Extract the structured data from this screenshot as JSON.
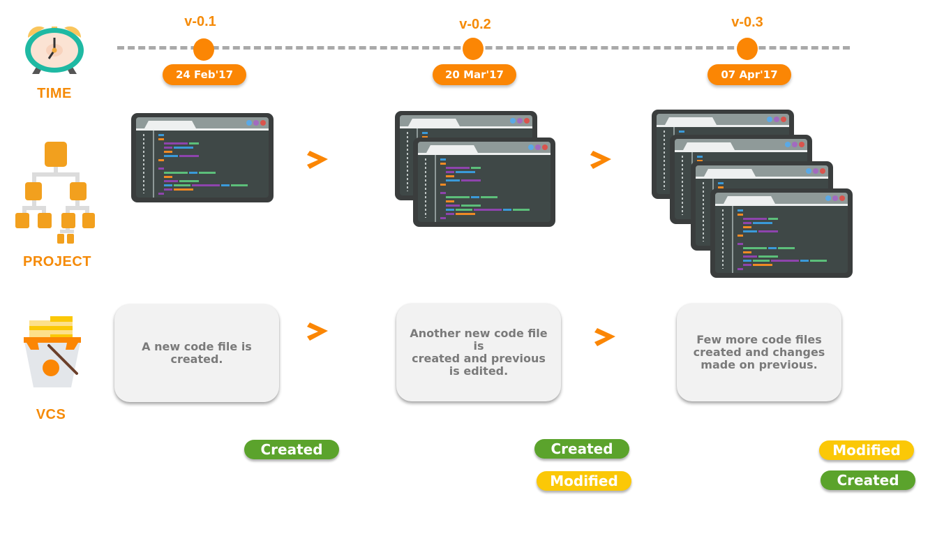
{
  "rows": {
    "time": {
      "label": "TIME",
      "icon": "alarm-clock-icon"
    },
    "project": {
      "label": "PROJECT",
      "icon": "hierarchy-tree-icon"
    },
    "vcs": {
      "label": "VCS",
      "icon": "vcs-bucket-icon"
    }
  },
  "versions": [
    {
      "version": "v-0.1",
      "date": "24 Feb'17",
      "description": "A new code file is\ncreated.",
      "file_count": 1,
      "badges": [
        {
          "label": "Created",
          "status": "created"
        }
      ]
    },
    {
      "version": "v-0.2",
      "date": "20 Mar'17",
      "description": "Another new code file is\ncreated and previous\nis edited.",
      "file_count": 2,
      "badges": [
        {
          "label": "Created",
          "status": "created"
        },
        {
          "label": "Modified",
          "status": "modified"
        }
      ]
    },
    {
      "version": "v-0.3",
      "date": "07 Apr'17",
      "description": "Few more code files\ncreated and changes\nmade on previous.",
      "file_count": 4,
      "badges": [
        {
          "label": "Modified",
          "status": "modified"
        },
        {
          "label": "Created",
          "status": "created"
        }
      ]
    }
  ],
  "arrows": {
    "symbol": "chevron-right-icon"
  },
  "colors": {
    "accent": "#fb8604",
    "created": "#5ba32c",
    "modified": "#fbc807",
    "card_bg": "#f2f2f2",
    "card_text": "#7a7a7a",
    "timeline": "#a9a9a9",
    "code_blue": "#3a9ad9",
    "code_orange": "#f08a24",
    "code_purple": "#8e44ad",
    "code_green": "#5cbf7a"
  }
}
